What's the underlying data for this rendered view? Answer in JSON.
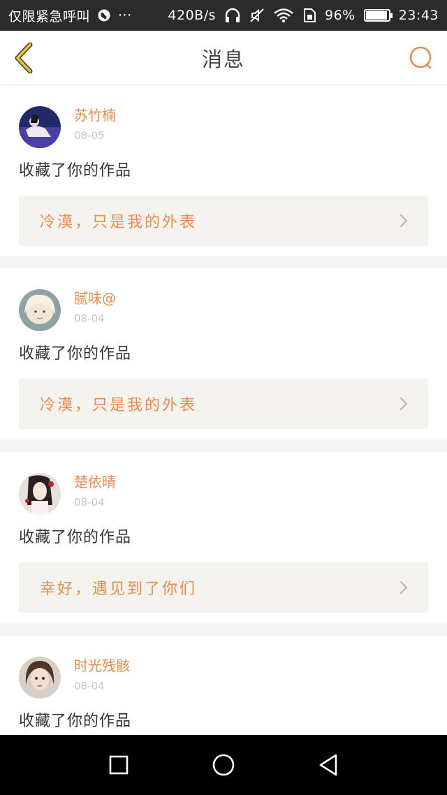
{
  "status_bar": {
    "carrier": "仅限紧急呼叫",
    "more": "···",
    "speed": "420B/s",
    "battery": "96%",
    "time": "23:43"
  },
  "header": {
    "title": "消息",
    "icons": {
      "back": "chevron-left-icon",
      "search": "search-icon"
    },
    "accent_color": "#f08a4b"
  },
  "messages": [
    {
      "name": "苏竹楠",
      "date": "08-05",
      "action": "收藏了你的作品",
      "work": "冷漠，只是我的外表"
    },
    {
      "name": "腻味@",
      "date": "08-04",
      "action": "收藏了你的作品",
      "work": "冷漠，只是我的外表"
    },
    {
      "name": "楚依晴",
      "date": "08-04",
      "action": "收藏了你的作品",
      "work": "幸好，遇见到了你们"
    },
    {
      "name": "时光残骸",
      "date": "08-04",
      "action": "收藏了你的作品",
      "work": ""
    }
  ],
  "nav_bar": {
    "icons": [
      "square-recent-icon",
      "circle-home-icon",
      "triangle-back-icon"
    ]
  }
}
